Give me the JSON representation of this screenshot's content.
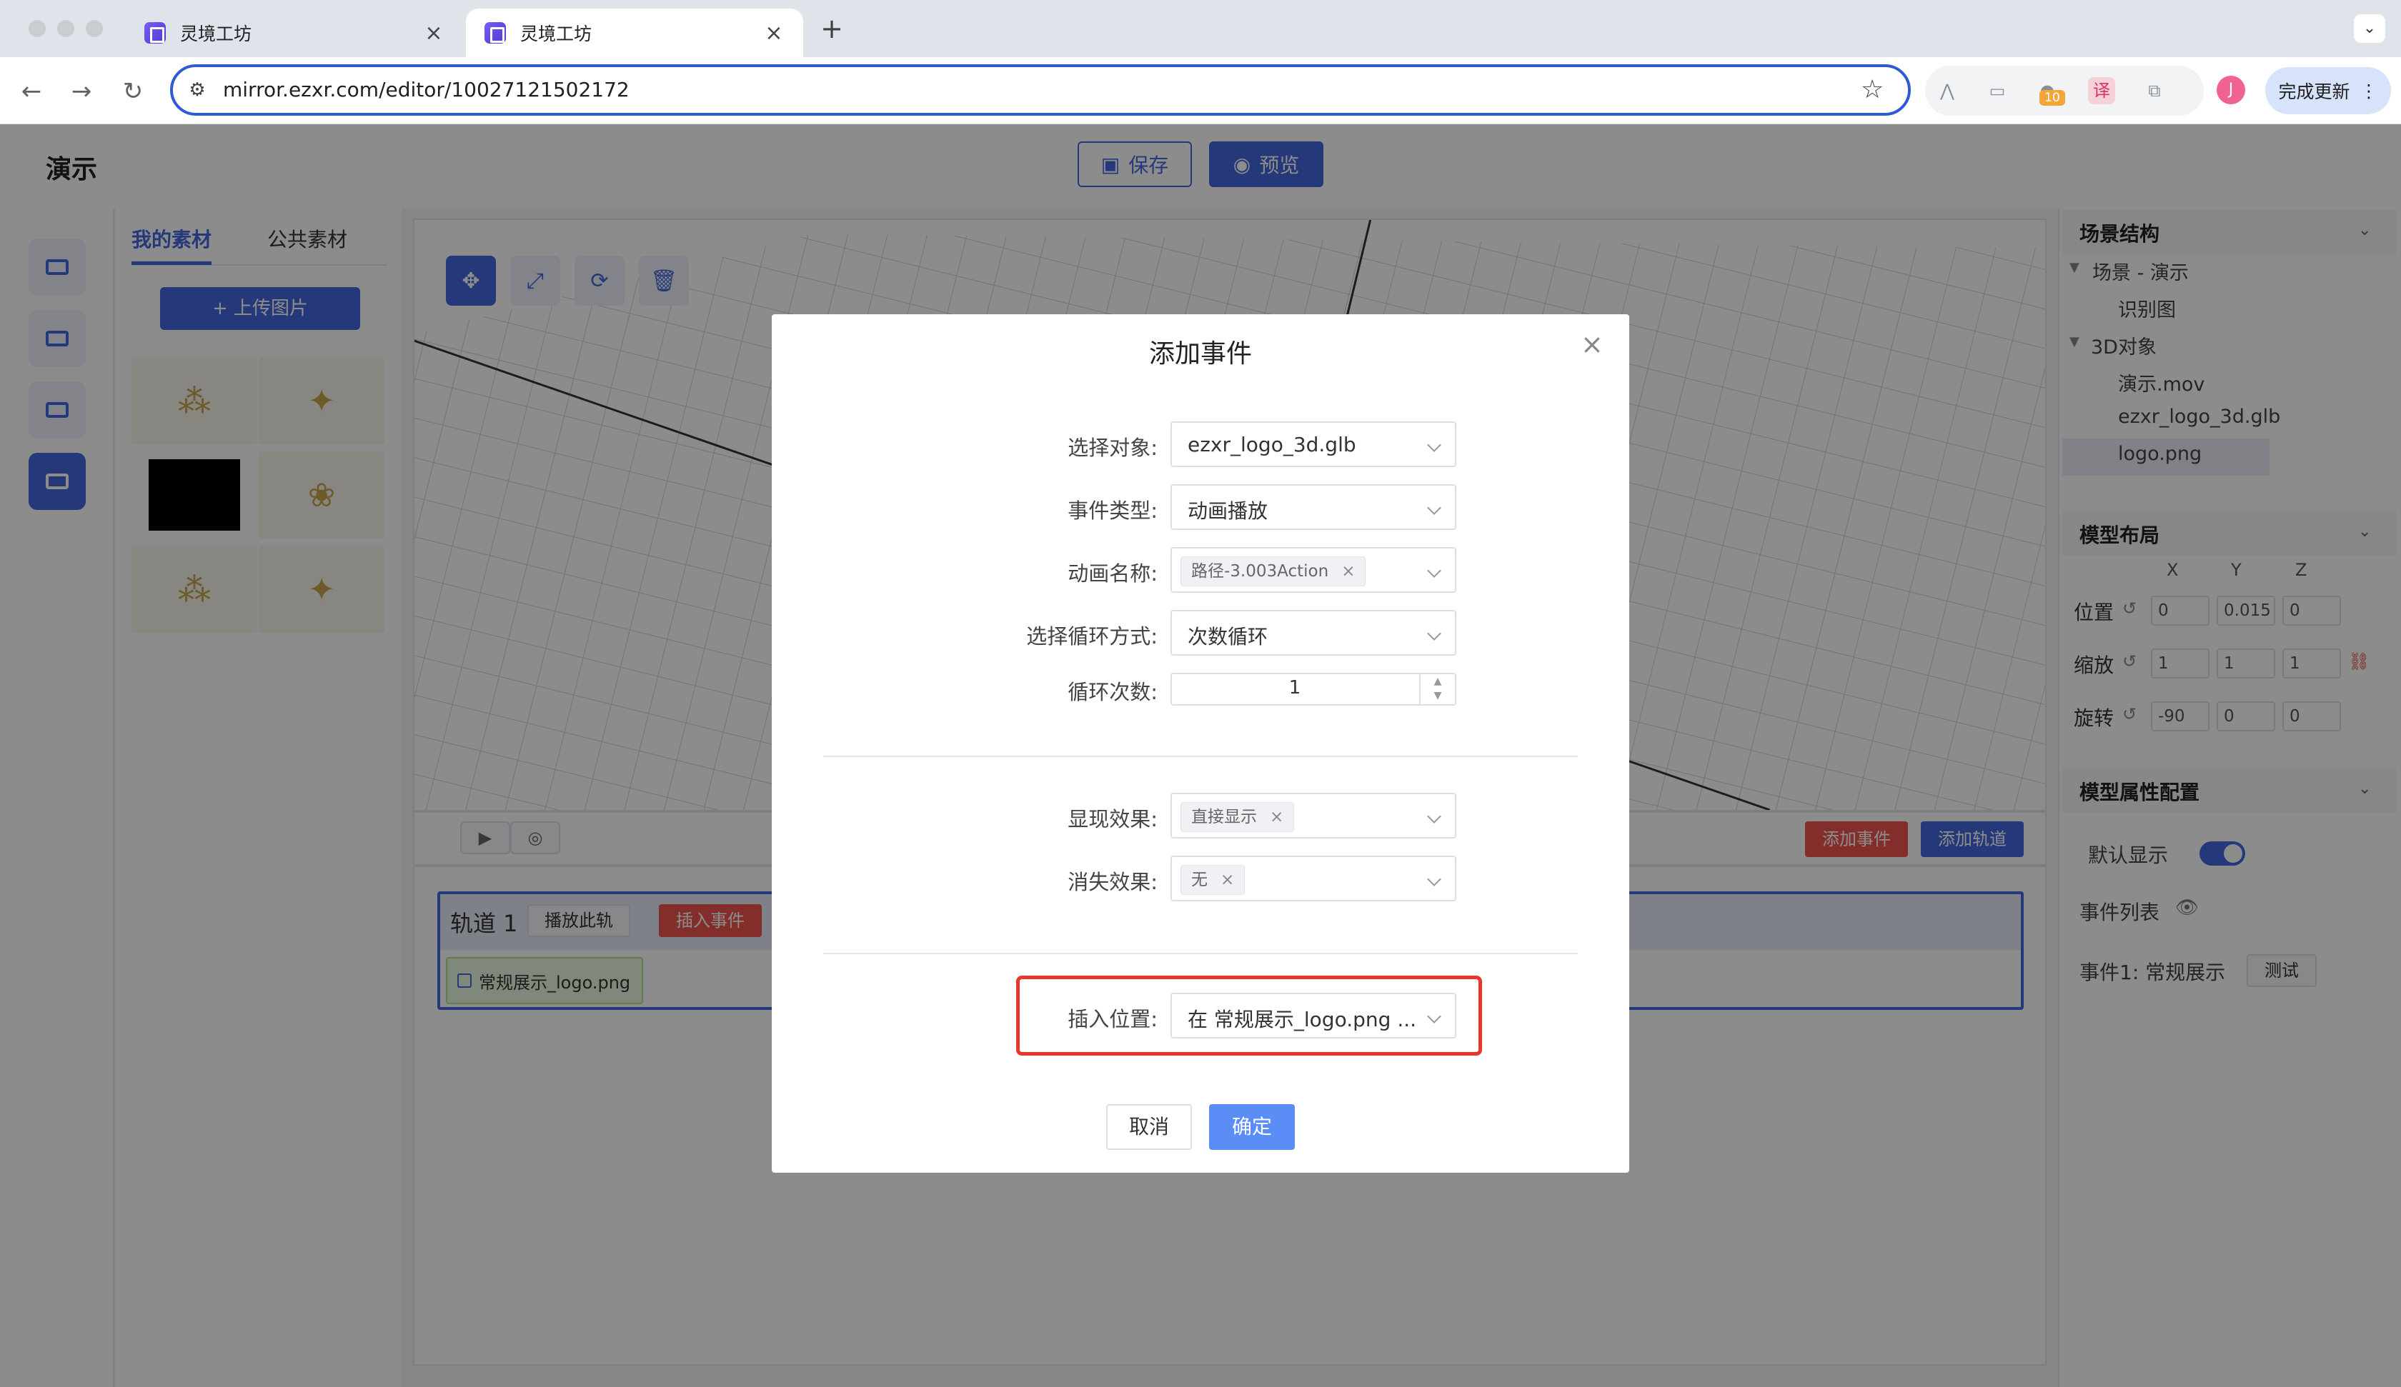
{
  "browser": {
    "tabs": [
      {
        "title": "灵境工坊"
      },
      {
        "title": "灵境工坊"
      }
    ],
    "tab_close_glyph": "×",
    "new_tab_glyph": "+",
    "tab_list_glyph": "⌄",
    "url": "mirror.ezxr.com/editor/10027121502172",
    "extension_badge": "10",
    "profile_initial": "J",
    "update_button": "完成更新",
    "menu_glyph": "⋮"
  },
  "app": {
    "title": "演示",
    "save_label": "保存",
    "preview_label": "预览"
  },
  "assets": {
    "tab_mine": "我的素材",
    "tab_public": "公共素材",
    "upload_label": "+ 上传图片"
  },
  "timeline": {
    "add_event": "添加事件",
    "add_track": "添加轨道",
    "track_name": "轨道 1",
    "play_track": "播放此轨",
    "insert_event": "插入事件",
    "clip_label": "常规展示_logo.png"
  },
  "right_panel": {
    "scene_structure": "场景结构",
    "tree": {
      "scene": "场景 - 演示",
      "marker": "识别图",
      "objects": "3D对象",
      "items": [
        "演示.mov",
        "ezxr_logo_3d.glb",
        "logo.png"
      ]
    },
    "model_layout": "模型布局",
    "axes": [
      "X",
      "Y",
      "Z"
    ],
    "position_label": "位置",
    "position": [
      "0",
      "0.015",
      "0"
    ],
    "scale_label": "缩放",
    "scale": [
      "1",
      "1",
      "1"
    ],
    "rotation_label": "旋转",
    "rotation": [
      "-90",
      "0",
      "0"
    ],
    "model_props": "模型属性配置",
    "default_show": "默认显示",
    "event_list": "事件列表",
    "event1": "事件1: 常规展示",
    "test_label": "测试"
  },
  "modal": {
    "title": "添加事件",
    "fields": {
      "target_label": "选择对象:",
      "target_value": "ezxr_logo_3d.glb",
      "type_label": "事件类型:",
      "type_value": "动画播放",
      "anim_label": "动画名称:",
      "anim_tag": "路径-3.003Action",
      "loop_mode_label": "选择循环方式:",
      "loop_mode_value": "次数循环",
      "loop_count_label": "循环次数:",
      "loop_count_value": "1",
      "appear_label": "显现效果:",
      "appear_tag": "直接显示",
      "disappear_label": "消失效果:",
      "disappear_tag": "无",
      "insert_label": "插入位置:",
      "insert_value": "在 常规展示_logo.png ..."
    },
    "cancel": "取消",
    "confirm": "确定"
  },
  "colors": {
    "accent": "#4466dd",
    "danger": "#f0554f",
    "confirm": "#5a8df5",
    "highlight": "#e8362d"
  }
}
